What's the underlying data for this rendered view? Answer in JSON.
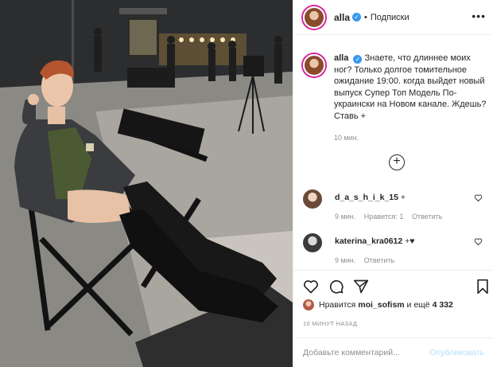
{
  "post": {
    "username": "alla",
    "header_separator": "•",
    "follow_label": "Подписки",
    "more_icon": "ellipsis-icon"
  },
  "caption": {
    "username": "alla",
    "text": "Знаете, что длиннее моих ног? Только долгое томительное ожидание 19:00. когда выйдет новый выпуск Супер Топ Модель По-украински на Новом канале. Ждешь? Ставь +",
    "time": "10 мин."
  },
  "load_more_icon": "plus-circle-icon",
  "comments": [
    {
      "username": "d_a_s_h_i_k_15",
      "text": "+",
      "time": "9 мин.",
      "likes": "Нравится: 1",
      "reply": "Ответить"
    },
    {
      "username": "katerina_kra0612",
      "text": "+♥",
      "time": "9 мин.",
      "reply": "Ответить"
    }
  ],
  "likes": {
    "prefix": "Нравится",
    "user": "moi_sofism",
    "middle": "и ещё",
    "count": "4 332"
  },
  "posted_ago": "10 МИНУТ НАЗАД",
  "comment_box": {
    "placeholder": "Добавьте комментарий...",
    "publish_label": "Опубликовать"
  },
  "colors": {
    "accent_blue": "#3897f0",
    "publish_disabled": "#b2dffc",
    "muted_text": "#8e8e8e"
  }
}
